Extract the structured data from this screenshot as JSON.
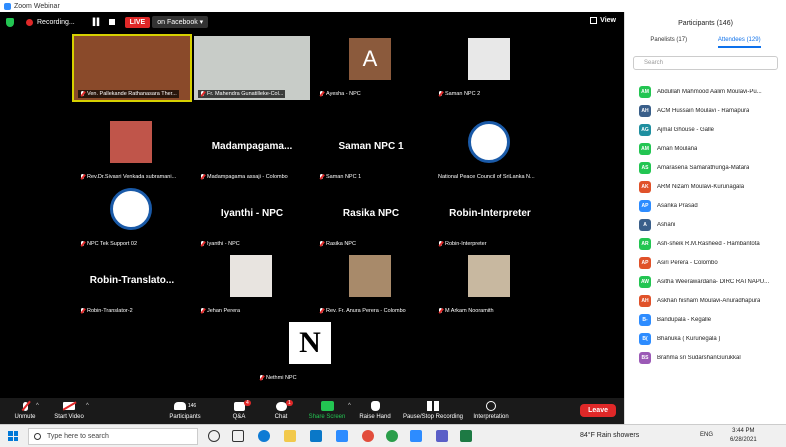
{
  "window": {
    "title": "Zoom Webinar"
  },
  "topbar": {
    "recording_label": "Recording...",
    "live_label": "LIVE",
    "live_platform": "on Facebook",
    "view_label": "View"
  },
  "tiles": [
    {
      "label": "Ven. Pallekande Rathanasara Ther...",
      "type": "video",
      "color": "#8a4a2a"
    },
    {
      "label": "Fr. Mahendra Gunatilleke-Col...",
      "type": "video",
      "color": "#c8ccc8"
    },
    {
      "label": "Ayesha - NPC",
      "type": "avatar",
      "initial": "A",
      "color": "#8b5a3c"
    },
    {
      "label": "Saman NPC 2",
      "type": "image",
      "color": "#e8e8e8"
    },
    {
      "label": "Rev.Dr.Sivasri Venkada subramani...",
      "type": "image",
      "color": "#c0554a"
    },
    {
      "label": "Madampagama assaji - Colombo",
      "type": "name",
      "big": "Madampagama..."
    },
    {
      "label": "Saman NPC 1",
      "type": "name",
      "big": "Saman NPC 1"
    },
    {
      "label": "National Peace Council of SriLanka N...",
      "type": "logo",
      "color": "#ffffff"
    },
    {
      "label": "NPC Tek Support 02",
      "type": "logo",
      "color": "#ffffff"
    },
    {
      "label": "Iyanthi - NPC",
      "type": "name",
      "big": "Iyanthi - NPC"
    },
    {
      "label": "Rasika NPC",
      "type": "name",
      "big": "Rasika NPC"
    },
    {
      "label": "Robin-Interpreter",
      "type": "name",
      "big": "Robin-Interpreter"
    },
    {
      "label": "Robin-Translator-2",
      "type": "name",
      "big": "Robin-Translato..."
    },
    {
      "label": "Jehan Perera",
      "type": "image",
      "color": "#e8e4e0"
    },
    {
      "label": "Rev. Fr. Anura Perera - Colombo",
      "type": "image",
      "color": "#a88a6a"
    },
    {
      "label": "M Arkam Nooramith",
      "type": "image",
      "color": "#c8b8a0"
    },
    {
      "label": "Nethmi NPC",
      "type": "letter",
      "initial": "N",
      "color": "#ffffff"
    }
  ],
  "toolbar": {
    "unmute": "Unmute",
    "start_video": "Start Video",
    "participants": "Participants",
    "participants_count": "146",
    "qa": "Q&A",
    "qa_badge": "4",
    "chat": "Chat",
    "chat_badge": "1",
    "share_screen": "Share Screen",
    "raise_hand": "Raise Hand",
    "pause_recording": "Pause/Stop Recording",
    "interpretation": "Interpretation",
    "leave": "Leave"
  },
  "panel": {
    "title": "Participants (146)",
    "tab_panelists": "Panelists (17)",
    "tab_attendees": "Attendees (129)",
    "search_placeholder": "Search",
    "attendees": [
      {
        "initials": "AM",
        "name": "Abdullah Mahmood Aalim Moulavi-Pu...",
        "color": "#23c552"
      },
      {
        "initials": "AH",
        "name": "ACM Hussain Moulavi - Ramapura",
        "color": "#3a5f8a"
      },
      {
        "initials": "AG",
        "name": "Ajmal Ghouse - Galle",
        "color": "#1f8fa0"
      },
      {
        "initials": "AM",
        "name": "Aman Moulana",
        "color": "#23c552"
      },
      {
        "initials": "AS",
        "name": "Amarasena Samarathunga-Matara",
        "color": "#23c552"
      },
      {
        "initials": "AK",
        "name": "ARM Nizam Moulavi-Kurunagala",
        "color": "#e0522a"
      },
      {
        "initials": "AP",
        "name": "Asanka Prasad",
        "color": "#2d8cff"
      },
      {
        "initials": "A",
        "name": "Ashani",
        "color": "#3a5f8a"
      },
      {
        "initials": "AR",
        "name": "Ash-sheik R.M.Rasheed - Hambantota",
        "color": "#23c552"
      },
      {
        "initials": "AP",
        "name": "Asiri Perera - Colombo",
        "color": "#e0522a"
      },
      {
        "initials": "AW",
        "name": "Asitha Weerawardana- DIRC RATNAPU...",
        "color": "#23c552"
      },
      {
        "initials": "AH",
        "name": "Askhan hisham Moulavi-Anuradhapura",
        "color": "#e0522a"
      },
      {
        "initials": "B-",
        "name": "Bandupala - Kegalle",
        "color": "#2d8cff"
      },
      {
        "initials": "B(",
        "name": "Bhanuka ( Kurunegala )",
        "color": "#2d8cff"
      },
      {
        "initials": "BS",
        "name": "Brahma sri SudarshanGurukkal",
        "color": "#9b59b6"
      }
    ]
  },
  "taskbar": {
    "search_placeholder": "Type here to search",
    "weather": "84°F  Rain showers",
    "lang": "ENG",
    "time": "3:44 PM",
    "date": "6/28/2021"
  }
}
